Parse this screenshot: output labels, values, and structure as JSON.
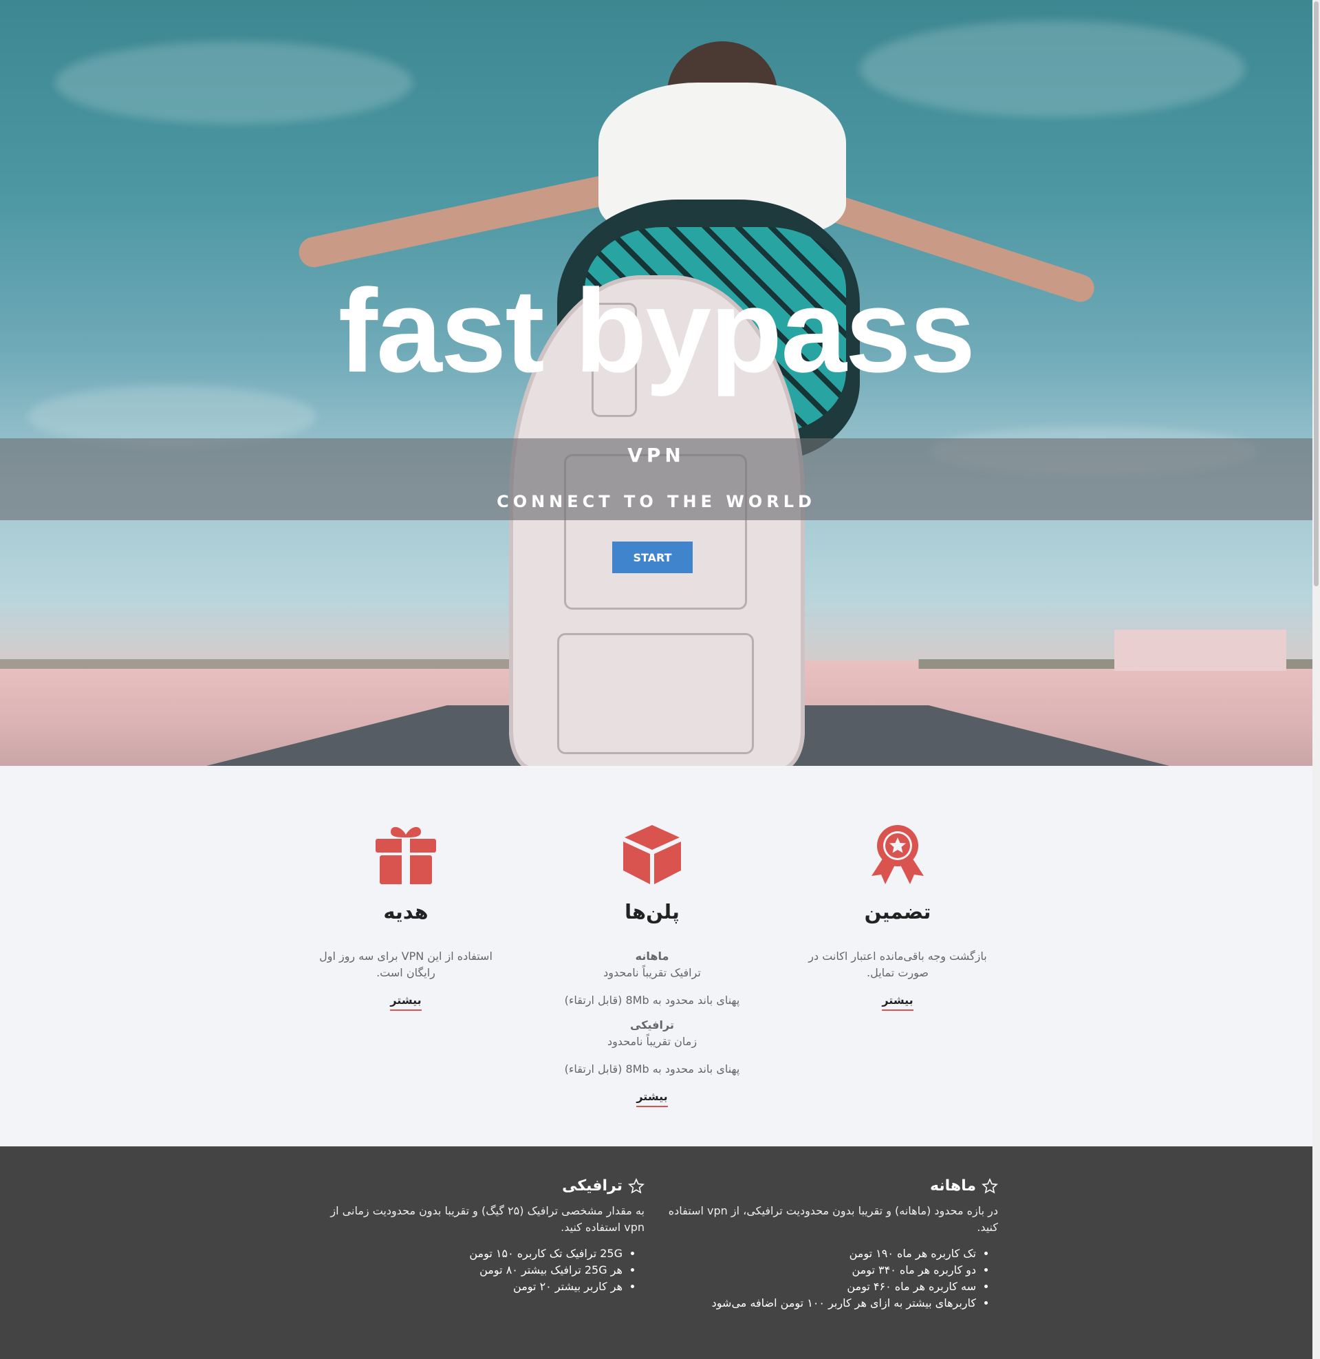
{
  "hero": {
    "title": "fast bypass",
    "subtitle": "VPN",
    "tagline": "CONNECT TO THE WORLD",
    "start_label": "START",
    "accent": "#3f84cc"
  },
  "features": {
    "icon_color": "#d9534f",
    "gift": {
      "icon": "gift-icon",
      "title": "هدیه",
      "desc": "استفاده از این VPN برای سه روز اول رایگان است.",
      "more": "بیشتر"
    },
    "plans": {
      "icon": "cube-icon",
      "title": "پلن‌ها",
      "items": [
        {
          "name": "ماهانه",
          "line1": "ترافیک تقریباً نامحدود",
          "line2": "پهنای باند محدود به 8Mb (قابل ارتقاء)"
        },
        {
          "name": "ترافیکی",
          "line1": "زمان تقریباً نامحدود",
          "line2": "پهنای باند محدود به 8Mb (قابل ارتقاء)"
        }
      ],
      "more": "بیشتر"
    },
    "guarantee": {
      "icon": "award-icon",
      "title": "تضمین",
      "desc": "بازگشت وجه باقی‌مانده اعتبار اکانت در صورت تمایل.",
      "more": "بیشتر"
    }
  },
  "pricing": {
    "background": "#444444",
    "monthly": {
      "icon": "star-icon",
      "title": "ماهانه",
      "desc": "در بازه محدود (ماهانه) و تقریبا بدون محدودیت ترافیکی، از vpn استفاده کنید.",
      "items": [
        "تک کاربره هر ماه ۱۹۰ تومن",
        "دو کاربره هر ماه ۳۴۰ تومن",
        "سه کاربره هر ماه ۴۶۰ تومن",
        "کاربرهای بیشتر به ازای هر کاربر ۱۰۰ تومن اضافه می‌شود"
      ]
    },
    "traffic": {
      "icon": "star-icon",
      "title": "ترافیکی",
      "desc": "به مقدار مشخصی ترافیک (۲۵ گیگ) و تقریبا بدون محدودیت زمانی از vpn استفاده کنید.",
      "items": [
        "25G ترافیک تک کاربره ۱۵۰ تومن",
        "هر 25G ترافیک بیشتر ۸۰ تومن",
        "هر کاربر بیشتر ۲۰ تومن"
      ]
    }
  }
}
